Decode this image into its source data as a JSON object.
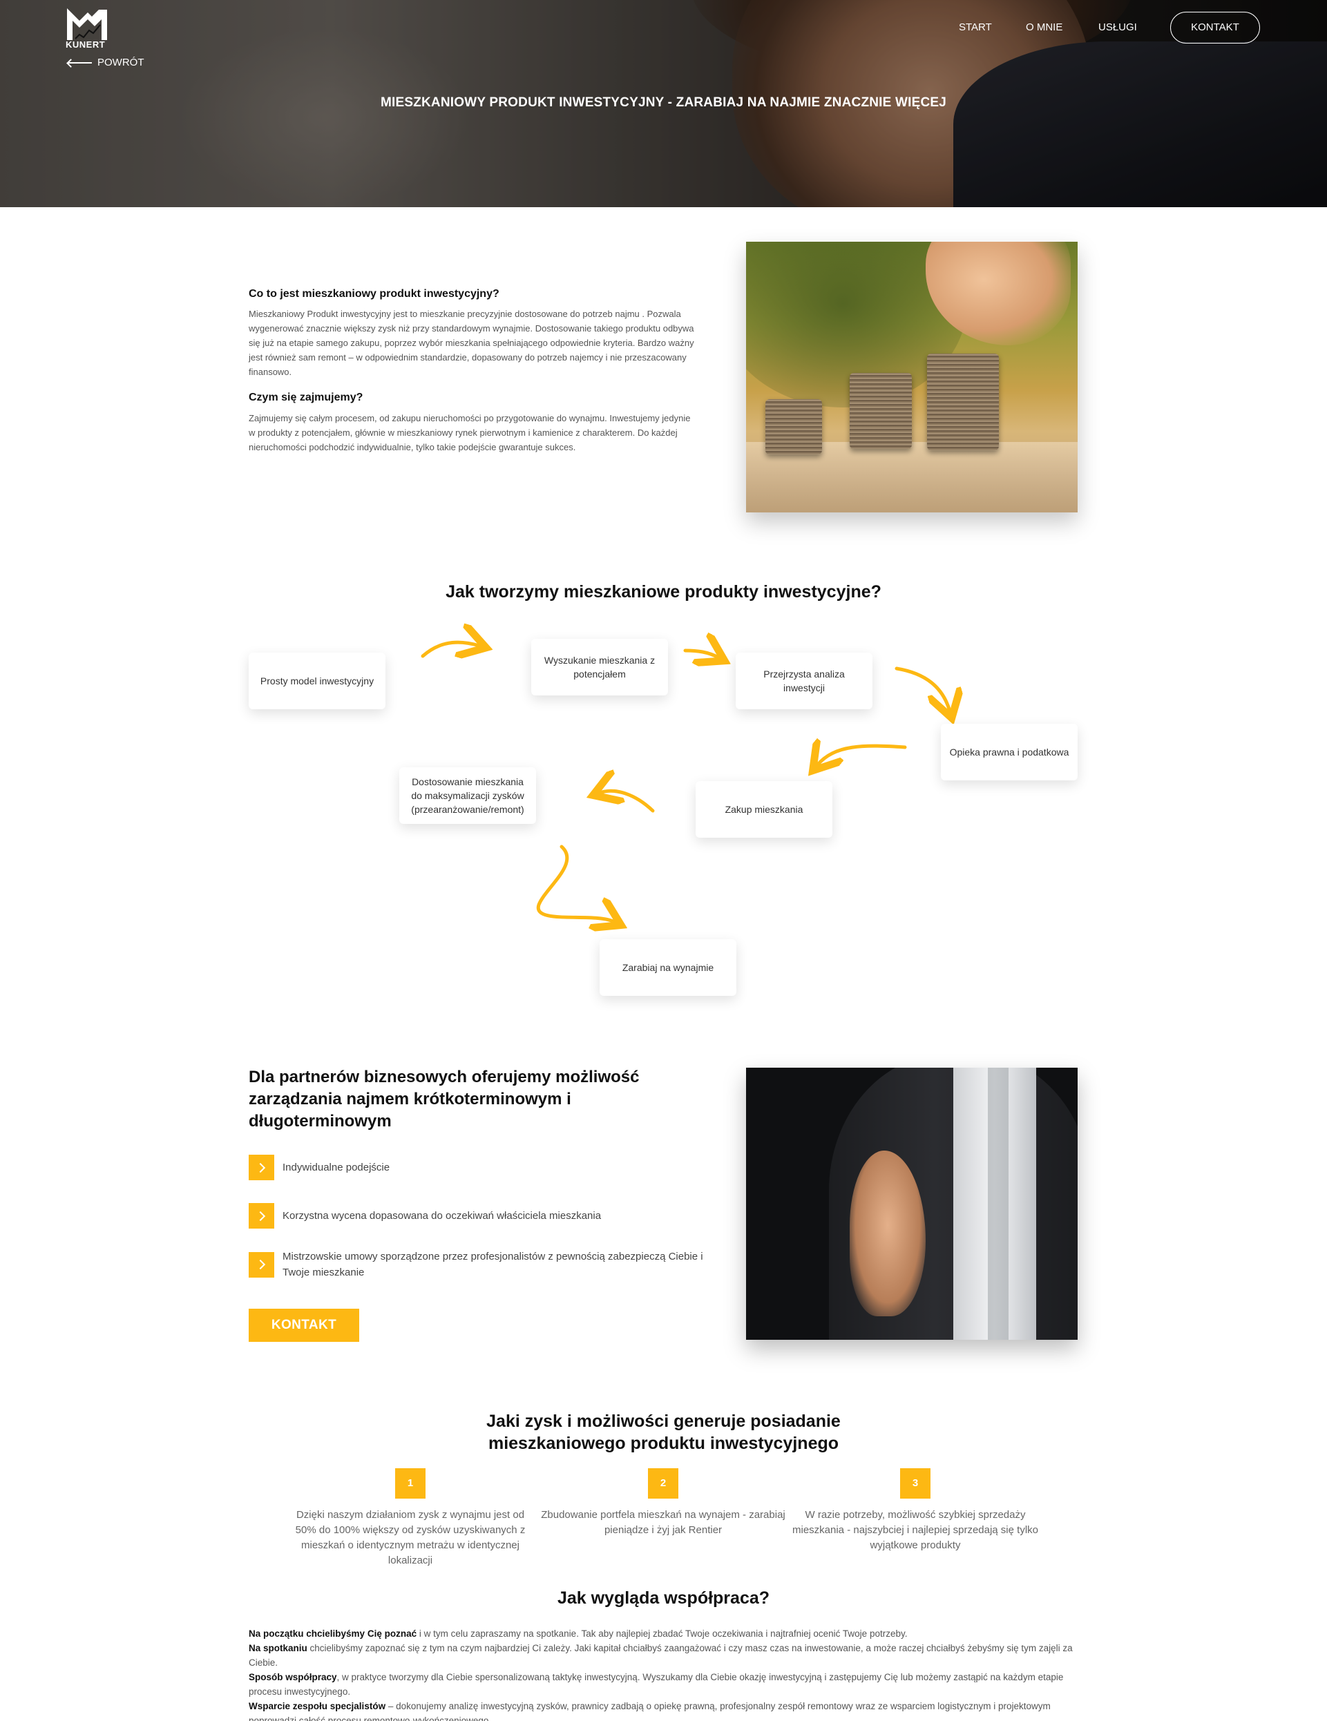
{
  "brand": {
    "logo_text": "KUNERT"
  },
  "nav": {
    "back_label": "POWRÓT",
    "items": [
      "START",
      "O MNIE",
      "USŁUGI"
    ],
    "contact_label": "KONTAKT"
  },
  "hero": {
    "title": "MIESZKANIOWY PRODUKT INWESTYCYJNY - ZARABIAJ NA NAJMIE ZNACZNIE WIĘCEJ"
  },
  "intro": {
    "q1": "Co to jest mieszkaniowy produkt inwestycyjny?",
    "a1": "Mieszkaniowy Produkt inwestycyjny jest to mieszkanie precyzyjnie dostosowane do potrzeb najmu . Pozwala wygenerować znacznie większy zysk niż przy standardowym wynajmie. Dostosowanie takiego produktu odbywa się już na etapie samego zakupu, poprzez wybór mieszkania spełniającego odpowiednie kryteria. Bardzo ważny jest również sam remont – w odpowiednim standardzie, dopasowany do potrzeb najemcy i nie przeszacowany finansowo.",
    "q2": "Czym się zajmujemy?",
    "a2": "Zajmujemy się całym procesem, od zakupu nieruchomości po przygotowanie do wynajmu. Inwestujemy jedynie w produkty z potencjałem, głównie w mieszkaniowy rynek pierwotnym i kamienice z charakterem. Do każdej nieruchomości podchodzić indywidualnie, tylko takie podejście gwarantuje sukces."
  },
  "process": {
    "title": "Jak tworzymy mieszkaniowe produkty inwestycyjne?",
    "steps": [
      "Prosty model inwestycyjny",
      "Wyszukanie mieszkania z potencjałem",
      "Przejrzysta analiza inwestycji",
      "Opieka prawna i podatkowa",
      "Zakup mieszkania",
      "Dostosowanie mieszkania do maksymalizacji zysków (przearanżowanie/remont)",
      "Zarabiaj na wynajmie"
    ],
    "arrow_color": "#fdb813"
  },
  "partners": {
    "title": "Dla partnerów biznesowych oferujemy możliwość zarządzania najmem krótkoterminowym i długoterminowym",
    "bullets": [
      "Indywidualne podejście",
      "Korzystna wycena dopasowana do oczekiwań właściciela mieszkania",
      "Mistrzowskie umowy sporządzone przez profesjonalistów z pewnością zabezpieczą Ciebie i Twoje mieszkanie"
    ],
    "button_label": "KONTAKT",
    "accent": "#fdb813"
  },
  "gain": {
    "title_line1": "Jaki zysk i możliwości generuje posiadanie",
    "title_line2": "mieszkaniowego produktu inwestycyjnego",
    "items": [
      {
        "num": "1",
        "text": "Dzięki naszym działaniom zysk z wynajmu jest od 50% do 100% większy od zysków uzyskiwanych z mieszkań o identycznym metrażu w identycznej lokalizacji"
      },
      {
        "num": "2",
        "text": "Zbudowanie portfela mieszkań na wynajem - zarabiaj pieniądze i żyj jak Rentier"
      },
      {
        "num": "3",
        "text": "W razie potrzeby, możliwość szybkiej sprzedaży mieszkania - najszybciej i najlepiej sprzedają się tylko wyjątkowe produkty"
      }
    ]
  },
  "coop": {
    "title": "Jak wygląda współpraca?",
    "paragraphs": [
      {
        "bold": "Na początku chcielibyśmy Cię poznać",
        "text": " i w tym celu zapraszamy na spotkanie. Tak aby najlepiej zbadać Twoje oczekiwania i najtrafniej ocenić Twoje potrzeby."
      },
      {
        "bold": "Na spotkaniu",
        "text": " chcielibyśmy zapoznać się z tym na czym najbardziej Ci zależy. Jaki kapitał chciałbyś zaangażować i czy masz czas na inwestowanie, a może raczej chciałbyś żebyśmy się tym zajęli za Ciebie."
      },
      {
        "bold": "Sposób współpracy",
        "text": ", w praktyce tworzymy dla Ciebie spersonalizowaną taktykę inwestycyjną. Wyszukamy dla Ciebie okazję inwestycyjną i zastępujemy Cię lub możemy zastąpić na każdym etapie procesu inwestycyjnego."
      },
      {
        "bold": "Wsparcie zespołu specjalistów",
        "text": " – dokonujemy analizę inwestycyjną zysków, prawnicy zadbają o opiekę prawną, profesjonalny zespół remontowy wraz ze wsparciem logistycznym i projektowym poprowadzi całość procesu remontowo-wykończeniowego."
      }
    ]
  }
}
